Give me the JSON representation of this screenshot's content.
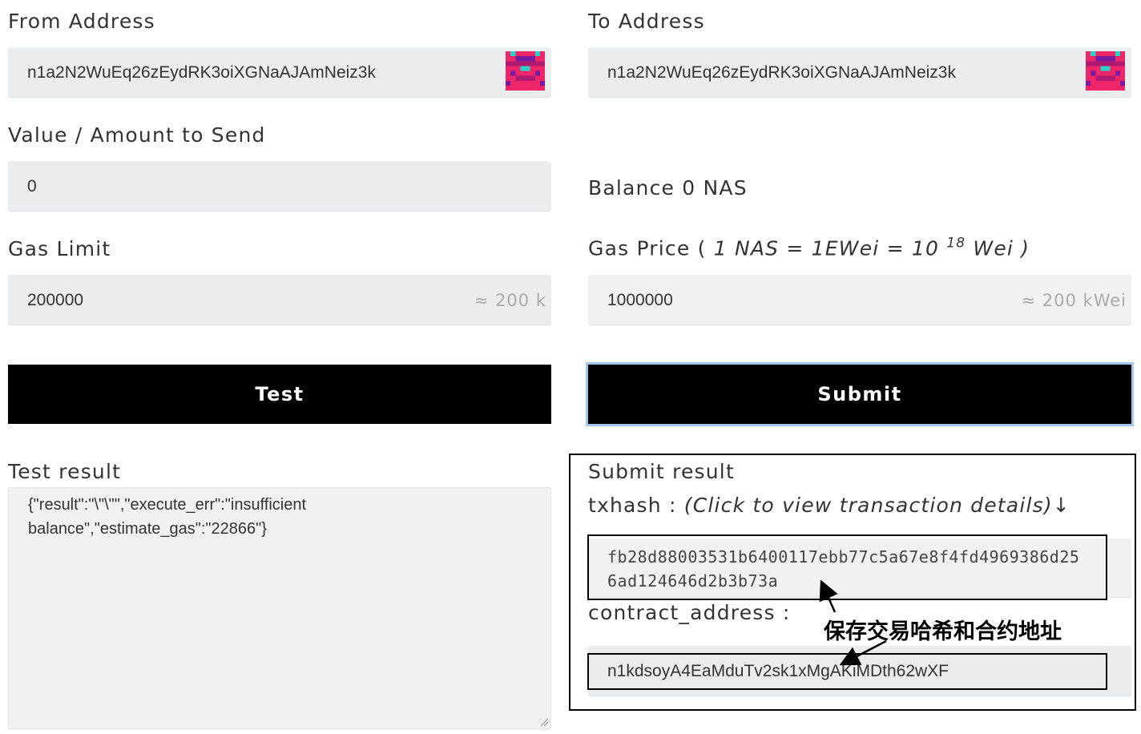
{
  "from": {
    "label": "From Address",
    "value": "n1a2N2WuEq26zEydRK3oiXGNaAJAmNeiz3k",
    "avatar_icon": "identicon-icon"
  },
  "to": {
    "label": "To Address",
    "value": "n1a2N2WuEq26zEydRK3oiXGNaAJAmNeiz3k",
    "avatar_icon": "identicon-icon"
  },
  "amount": {
    "label": "Value / Amount to Send",
    "value": "0"
  },
  "balance": {
    "text": "Balance 0 NAS"
  },
  "gas_limit": {
    "label": "Gas Limit",
    "value": "200000",
    "hint": "≈ 200 k"
  },
  "gas_price": {
    "label_prefix": "Gas Price ( ",
    "label_italic": "1 NAS = 1EWei = 10 ",
    "label_sup": "18",
    "label_suffix": " Wei )",
    "value": "1000000",
    "hint": "≈ 200 kWei"
  },
  "buttons": {
    "test": "Test",
    "submit": "Submit"
  },
  "test_result": {
    "label": "Test result",
    "text": "{\"result\":\"\\\"\\\"\",\"execute_err\":\"insufficient balance\",\"estimate_gas\":\"22866\"}"
  },
  "submit_result": {
    "label": "Submit result",
    "txhash_label": "txhash : ",
    "txhash_hint": "(Click to view transaction details)↓",
    "txhash_line1": "fb28d88003531b6400117ebb77c5a67e8f4fd4969386d25",
    "txhash_line2": "6ad124646d2b3b73a",
    "contract_label": "contract_address :",
    "contract_value": "n1kdsoyA4EaMduTv2sk1xMgAKiMDth62wXF"
  },
  "annotation": {
    "text": "保存交易哈希和合约地址"
  },
  "colors": {
    "field_bg": "#ebeced",
    "button_bg": "#000000",
    "focus_ring": "#a9c6f2",
    "identicon_primary": "#f0266b",
    "identicon_accent": "#2bd3c7"
  }
}
